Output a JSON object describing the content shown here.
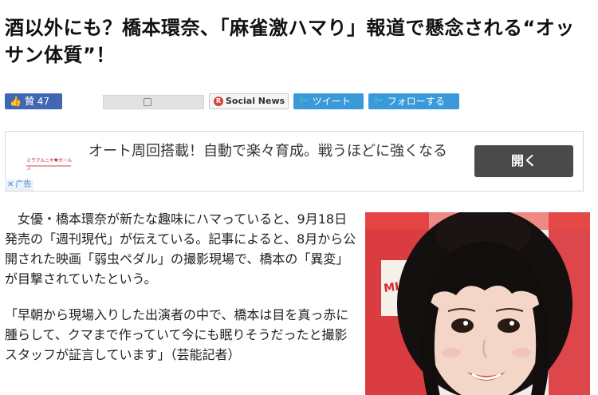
{
  "headline": "酒以外にも？橋本環奈、「麻雀激ハマり」報道で懸念される“オッサン体質”！",
  "share_bar": {
    "like_label": "贊 47",
    "social_news_label": "Social News",
    "tweet_label": "ツイート",
    "follow_label": "フォローする"
  },
  "ad": {
    "logo_text": "ミラクルニキ♥ガールズ",
    "text": "オート周回搭載！自動で楽々育成。戦うほどに強くなる",
    "open_button": "開く",
    "badge_text": "广告"
  },
  "article": {
    "paragraphs": [
      "女優・橋本環奈が新たな趣味にハマっていると、9月18日発売の「週刊現代」が伝えている。記事によると、8月から公開された映画「弱虫ペダル」の撮影現場で、橋本の「異変」が目撃されていたという。",
      "「早朝から現場入りした出演者の中で、橋本は目を真っ赤に腫らして、クマまで作っていて今にも眠りそうだったと撮影スタッフが証言しています」（芸能記者）"
    ]
  },
  "photo_backdrop_text": "MILLERY",
  "colors": {
    "facebook": "#4267b2",
    "twitter": "#3a9ad9",
    "ad_button": "#4a4a4a",
    "backdrop_red": "#d8292f"
  }
}
